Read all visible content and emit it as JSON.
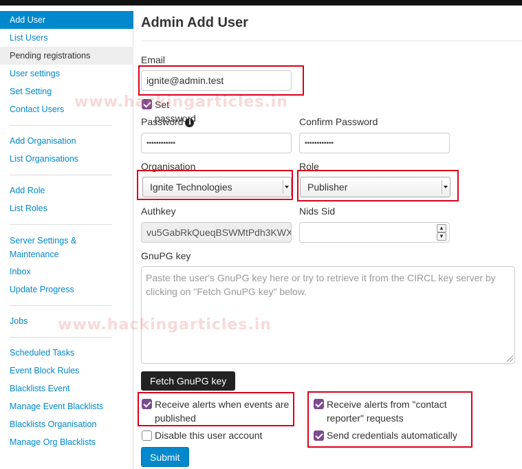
{
  "sidebar": {
    "items": [
      {
        "label": "Add User"
      },
      {
        "label": "List Users"
      },
      {
        "label": "Pending registrations"
      },
      {
        "label": "User settings"
      },
      {
        "label": "Set Setting"
      },
      {
        "label": "Contact Users"
      },
      {
        "label": "Add Organisation"
      },
      {
        "label": "List Organisations"
      },
      {
        "label": "Add Role"
      },
      {
        "label": "List Roles"
      },
      {
        "label": "Server Settings & Maintenance"
      },
      {
        "label": "Inbox"
      },
      {
        "label": "Update Progress"
      },
      {
        "label": "Jobs"
      },
      {
        "label": "Scheduled Tasks"
      },
      {
        "label": "Event Block Rules"
      },
      {
        "label": "Blacklists Event"
      },
      {
        "label": "Manage Event Blacklists"
      },
      {
        "label": "Blacklists Organisation"
      },
      {
        "label": "Manage Org Blacklists"
      }
    ]
  },
  "page": {
    "title": "Admin Add User"
  },
  "form": {
    "email_label": "Email",
    "email_value": "ignite@admin.test",
    "set_password_label": "Set password",
    "password_label": "Password",
    "password_value": "••••••••••••",
    "confirm_password_label": "Confirm Password",
    "confirm_password_value": "••••••••••••",
    "organisation_label": "Organisation",
    "organisation_value": "Ignite Technologies",
    "role_label": "Role",
    "role_value": "Publisher",
    "authkey_label": "Authkey",
    "authkey_value": "vu5GabRkQueqBSWMtPdh3KWX",
    "nids_label": "Nids Sid",
    "gnupg_label": "GnuPG key",
    "gnupg_placeholder": "Paste the user's GnuPG key here or try to retrieve it from the CIRCL key server by clicking on \"Fetch GnuPG key\" below.",
    "fetch_button": "Fetch GnuPG key",
    "receive_alerts_label": "Receive alerts when events are published",
    "contact_reporter_label": "Receive alerts from \"contact reporter\" requests",
    "disable_label": "Disable this user account",
    "send_credentials_label": "Send credentials automatically",
    "submit_button": "Submit"
  },
  "watermark": "www.hackingarticles.in",
  "colors": {
    "accent": "#0088cc",
    "checkbox": "#7b4b8e",
    "annotation": "#d9001b"
  }
}
